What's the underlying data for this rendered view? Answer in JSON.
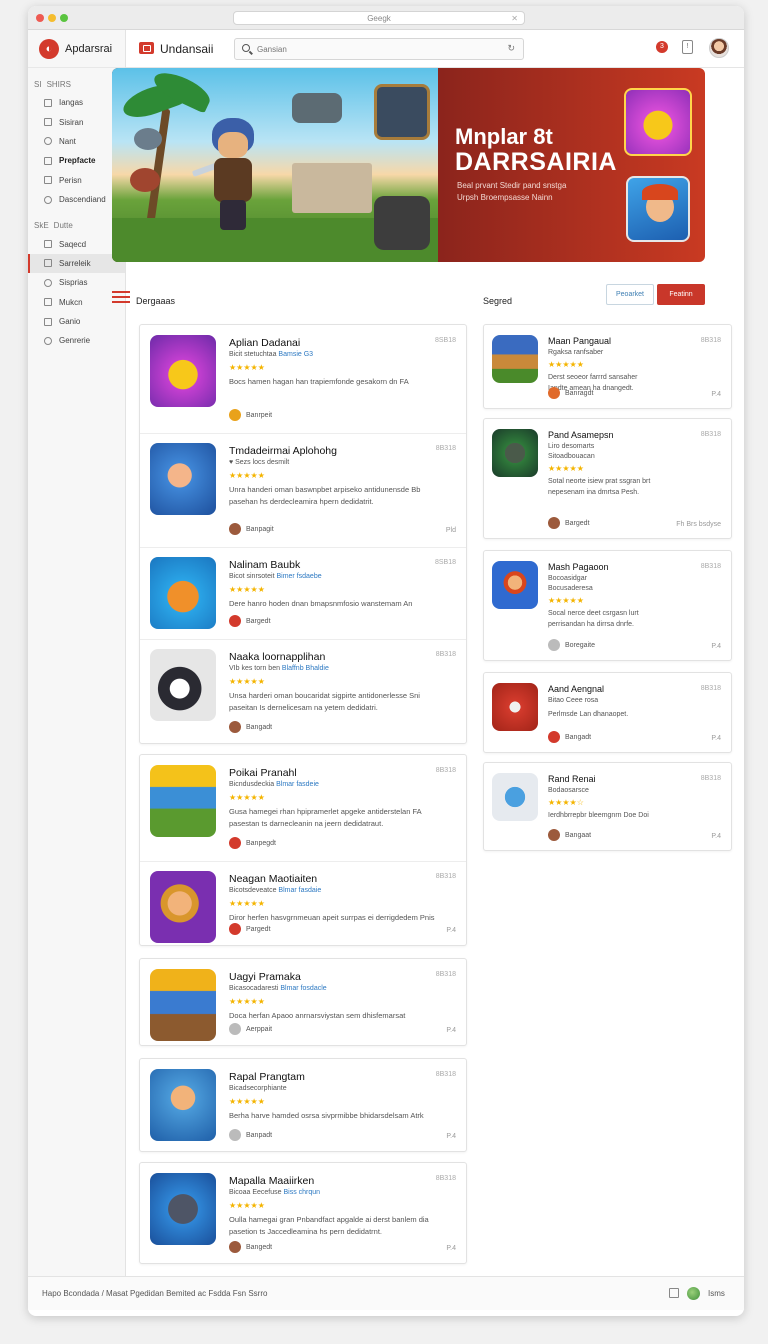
{
  "browser": {
    "url": "Geegk"
  },
  "sidebar": {
    "brand": "Apdarsrai",
    "sections": [
      {
        "head_icon": "SI",
        "head": "SHIRS",
        "items": [
          {
            "label": "Iangas",
            "bold": false
          },
          {
            "label": "Sisiran",
            "bold": false
          },
          {
            "label": "Nant",
            "bold": false
          },
          {
            "label": "Prepfacte",
            "bold": true
          },
          {
            "label": "Perisn",
            "bold": false
          },
          {
            "label": "Dascendiand",
            "bold": false
          }
        ]
      },
      {
        "head_icon": "SkE",
        "head": "Dutte",
        "items": [
          {
            "label": "Saqecd",
            "bold": false
          },
          {
            "label": "Sarreleik",
            "bold": false,
            "selected": true
          },
          {
            "label": "Sisprias",
            "bold": false
          },
          {
            "label": "Mukcn",
            "bold": false
          },
          {
            "label": "Ganio",
            "bold": false
          },
          {
            "label": "Genrerie",
            "bold": false
          }
        ]
      }
    ]
  },
  "topbar": {
    "title": "Undansaii",
    "search_placeholder": "Gansian",
    "notification_count": "3",
    "help_glyph": "!"
  },
  "banner": {
    "title_line1": "Mnplar 8t",
    "title_line2": "DARRSAIRIA",
    "subtitle_line1": "Beal prvant Stedir pand snstga",
    "subtitle_line2": "Urpsh Broempsasse Nainn"
  },
  "sections": {
    "left_title": "Dergaaas",
    "right_title": "Segred",
    "popular_label": "Peoarket",
    "featured_label": "Featinn"
  },
  "left_apps": [
    {
      "title": "Aplian Dadanai",
      "meta": "Bicit stetuchtaa ",
      "meta_link": "Bamsie G3",
      "stars": "★★★★★",
      "desc": [
        "Bocs hamen hagan han trapiemfonde gesakorn dn FA"
      ],
      "code": "8SB18",
      "publisher": "Banrpeit",
      "size": "",
      "color": "#e9a21b"
    },
    {
      "title": "Tmdadeirmai Aplohohg",
      "meta": "♥ Sezs locs desmilt",
      "meta_link": "",
      "stars": "★★★★★",
      "desc": [
        "Unra handeri oman baswnpbet arpiseko antidunensde Bb",
        "pasehan hs derdecleamira hpern dedidatrit."
      ],
      "code": "8B318",
      "publisher": "Banpagit",
      "size": "Pld",
      "color": "#9c5a3c"
    },
    {
      "title": "Nalinam Baubk",
      "meta": "Bicot sinrsoteit ",
      "meta_link": "Bimer fsdaebe",
      "stars": "★★★★★",
      "desc": [
        "Dere hanro hoden dnan bmapsnmfosio wanstemam An"
      ],
      "code": "8SB18",
      "publisher": "Bargedt",
      "size": "",
      "color": "#d33a2c"
    },
    {
      "title": "Naaka loornapplihan",
      "meta": "VIb kes torn ben ",
      "meta_link": "Blaffnb Bhaldie",
      "stars": "★★★★★",
      "desc": [
        "Unsa harderi oman boucaridat sigpirte antidonerlesse Sni",
        "paseitan Is dernelicesam na yetem dedidatri."
      ],
      "code": "8B318",
      "publisher": "Bangadt",
      "size": "",
      "color": "#9c5a3c"
    },
    {
      "title": "Poikai Pranahl",
      "meta": "Bicndusdeckia ",
      "meta_link": "Blmar fasdeie",
      "stars": "★★★★★",
      "desc": [
        "Gusa hamegei rhan hpipramerlet apgeke antiderstelan FA",
        "pasestan ts darnecleanin na jeern dedidatraut."
      ],
      "code": "8B318",
      "publisher": "Banpegdt",
      "size": "",
      "color": "#d33a2c"
    },
    {
      "title": "Neagan Maotiaiten",
      "meta": "Bicotsdeveatce ",
      "meta_link": "Blmar fasdaie",
      "stars": "★★★★★",
      "desc": [
        "Diror herfen hasvgrnmeuan apeit surrpas ei derrigdedem Pnis"
      ],
      "code": "8B318",
      "publisher": "Pargedt",
      "size": "P.4",
      "color": "#d33a2c"
    },
    {
      "title": "Uagyi Pramaka",
      "meta": "Bicasocadaresti ",
      "meta_link": "Blmar fosdacle",
      "stars": "★★★★★",
      "desc": [
        "Doca herfan Apaoo anrnarsviystan sem dhisfemarsat"
      ],
      "code": "8B318",
      "publisher": "Aerppait",
      "size": "P.4",
      "color": "#bbbbbb"
    },
    {
      "title": "Rapal Prangtam",
      "meta": "Bicadsecorphiante",
      "meta_link": "",
      "stars": "★★★★★",
      "desc": [
        "Berha harve hamded osrsa sivprmibbe bhidarsdelsam Atrk"
      ],
      "code": "8B318",
      "publisher": "Banpadt",
      "size": "P.4",
      "color": "#bbbbbb"
    },
    {
      "title": "Mapalla Maaiirken",
      "meta": "Bicoaa Eecefuse ",
      "meta_link": "Biss chrqun",
      "stars": "★★★★★",
      "desc": [
        "Oulla hamegai gran Pnbandfact apgalde ai derst banlem dia",
        "pasetion ts Jaccedleamina hs pern dedidatrnt."
      ],
      "code": "8B318",
      "publisher": "Bangedt",
      "size": "P.4",
      "color": "#9c5a3c"
    }
  ],
  "right_apps": [
    {
      "title": "Maan Pangaual",
      "meta": "Rgaksa ranfsaber",
      "stars": "★★★★★",
      "desc": [
        "Derst seoeor farrrd sansaher",
        "Iandte amean ha dnangedt."
      ],
      "code": "8B318",
      "publisher": "Banragdt",
      "size": "P.4",
      "extra": "",
      "color": "#e06a2b"
    },
    {
      "title": "Pand Asamepsn",
      "meta": "Liro desomarts",
      "meta2": "Sitoadbouacan",
      "stars": "★★★★★",
      "desc": [
        "Sotal neorte isiew prat ssgran brt",
        "nepesenam ina dmrtsa Pesh."
      ],
      "code": "8B318",
      "publisher": "Bargedt",
      "size": "",
      "extra": "Fh Brs bsdyse",
      "color": "#9c5a3c"
    },
    {
      "title": "Mash Pagaoon",
      "meta": "Bocoasidgar",
      "meta2": "Bocusaderesa",
      "stars": "★★★★★",
      "desc": [
        "Socal nerce deet csrgasn lurt",
        "perrisandan ha dirrsa dnrfe."
      ],
      "code": "8B318",
      "publisher": "Boregaite",
      "size": "P.4",
      "extra": "",
      "color": "#bbbbbb"
    },
    {
      "title": "Aand Aengnal",
      "meta": "Bitao Ceee rosa",
      "stars": "",
      "desc": [
        "Perlmsde Lan dhanaopet."
      ],
      "code": "8B318",
      "publisher": "Bangadt",
      "size": "P.4",
      "extra": "",
      "color": "#d33a2c"
    },
    {
      "title": "Rand Renai",
      "meta": "Bodaosarsce",
      "stars": "★★★★☆",
      "desc": [
        "Ierdhbrrepbr bleemgnrn Doe Doi"
      ],
      "code": "8B318",
      "publisher": "Bangaat",
      "size": "P.4",
      "extra": "",
      "color": "#9c5a3c"
    }
  ],
  "footer": {
    "text": "Hapo Bcondada /   Masat  Pgedidan  Bemited  ac  Fsdda  Fsn Ssrro",
    "lang": "Isms"
  },
  "colors": {
    "accent": "#d33a2c",
    "link": "#2d79c2",
    "star": "#f4b400"
  }
}
